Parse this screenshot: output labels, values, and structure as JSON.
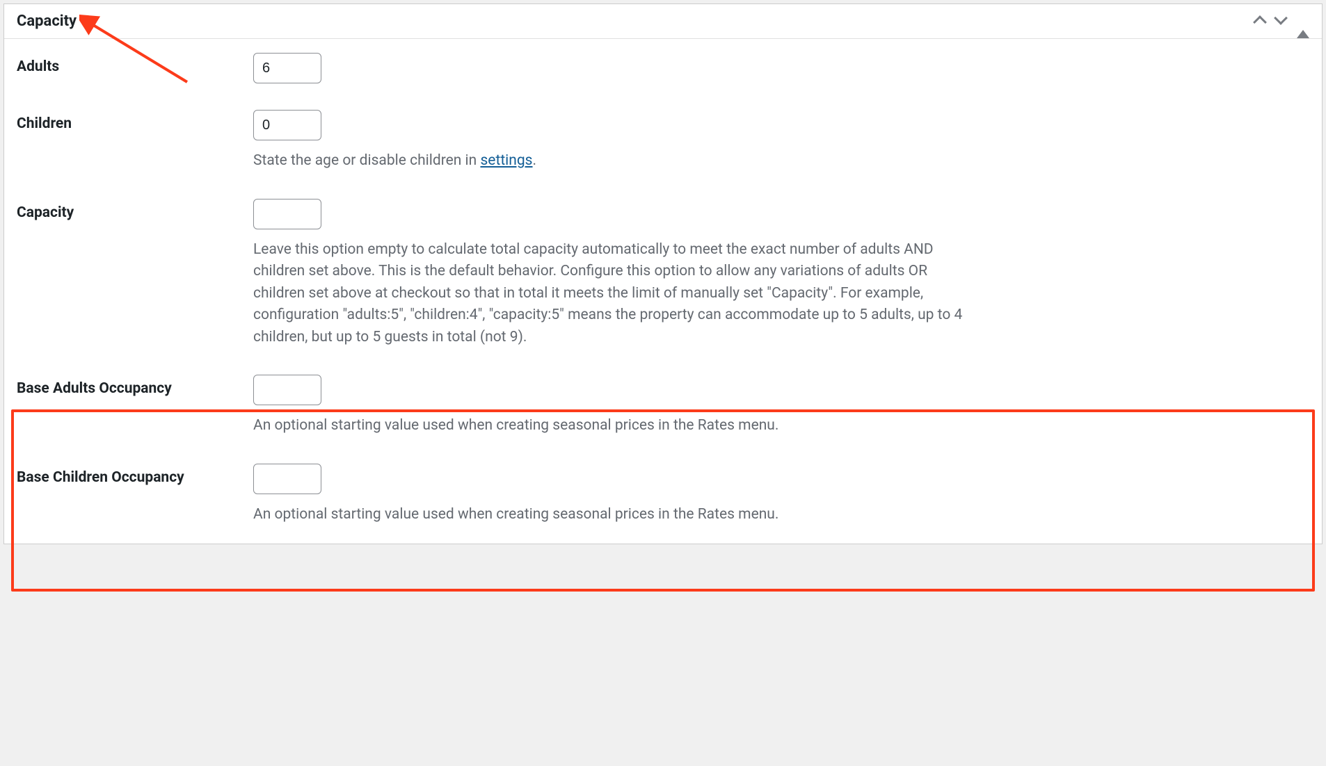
{
  "panel": {
    "title": "Capacity"
  },
  "fields": {
    "adults": {
      "label": "Adults",
      "value": "6"
    },
    "children": {
      "label": "Children",
      "value": "0",
      "help_prefix": "State the age or disable children in ",
      "help_link": "settings",
      "help_suffix": "."
    },
    "capacity": {
      "label": "Capacity",
      "value": "",
      "help": "Leave this option empty to calculate total capacity automatically to meet the exact number of adults AND children set above. This is the default behavior. Configure this option to allow any variations of adults OR children set above at checkout so that in total it meets the limit of manually set \"Capacity\". For example, configuration \"adults:5\", \"children:4\", \"capacity:5\" means the property can accommodate up to 5 adults, up to 4 children, but up to 5 guests in total (not 9)."
    },
    "base_adults": {
      "label": "Base Adults Occupancy",
      "value": "",
      "help": "An optional starting value used when creating seasonal prices in the Rates menu."
    },
    "base_children": {
      "label": "Base Children Occupancy",
      "value": "",
      "help": "An optional starting value used when creating seasonal prices in the Rates menu."
    }
  }
}
